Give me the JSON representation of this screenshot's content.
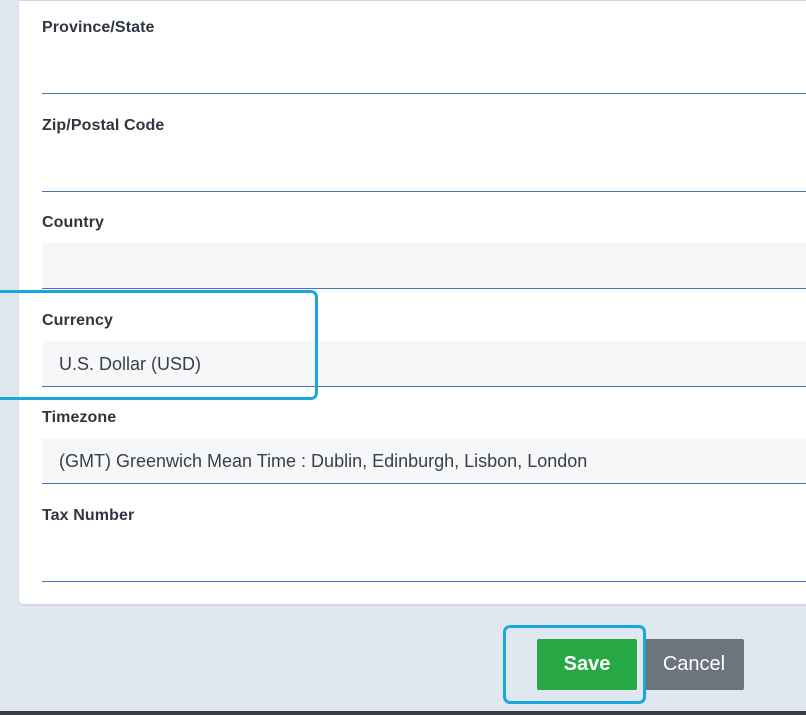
{
  "form": {
    "province": {
      "label": "Province/State",
      "value": ""
    },
    "zip": {
      "label": "Zip/Postal Code",
      "value": ""
    },
    "country": {
      "label": "Country",
      "value": ""
    },
    "currency": {
      "label": "Currency",
      "value": "U.S. Dollar (USD)"
    },
    "timezone": {
      "label": "Timezone",
      "value": "(GMT) Greenwich Mean Time : Dublin, Edinburgh, Lisbon, London"
    },
    "tax_number": {
      "label": "Tax Number",
      "value": ""
    }
  },
  "actions": {
    "save_label": "Save",
    "cancel_label": "Cancel"
  },
  "colors": {
    "page_background": "#e1e7f0",
    "input_underline": "#3f74c3",
    "save_button": "#28a745",
    "cancel_button": "#6c747d",
    "highlight_outline": "#1aa8dc"
  }
}
